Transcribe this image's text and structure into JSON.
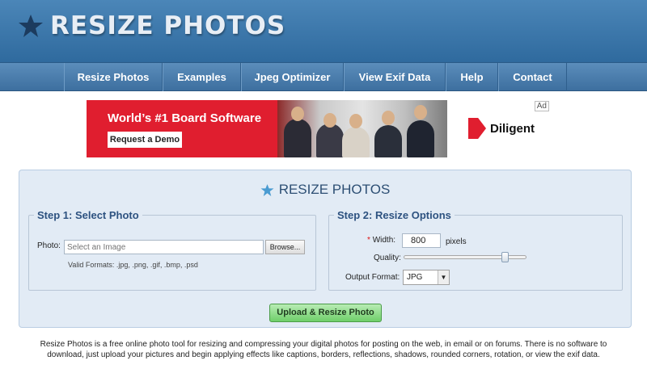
{
  "header": {
    "logo_text": "RESIZE PHOTOS",
    "logo_icon": "star-icon"
  },
  "nav": {
    "items": [
      {
        "label": "Resize Photos"
      },
      {
        "label": "Examples"
      },
      {
        "label": "Jpeg Optimizer"
      },
      {
        "label": "View Exif Data"
      },
      {
        "label": "Help"
      },
      {
        "label": "Contact"
      }
    ]
  },
  "ad": {
    "title": "World’s #1 Board Software",
    "cta": "Request a Demo",
    "brand": "Diligent",
    "badge": "Ad"
  },
  "panel": {
    "title": "RESIZE PHOTOS",
    "step1": {
      "legend": "Step 1: Select Photo",
      "photo_label": "Photo:",
      "photo_placeholder": "Select an Image",
      "browse_label": "Browse...",
      "valid_formats": "Valid Formats: .jpg, .png, .gif, .bmp, .psd"
    },
    "step2": {
      "legend": "Step 2: Resize Options",
      "required_mark": "*",
      "width_label": "Width:",
      "width_value": "800",
      "width_unit": "pixels",
      "quality_label": "Quality:",
      "quality_value": 0.85,
      "format_label": "Output Format:",
      "format_value": "JPG"
    },
    "submit_label": "Upload & Resize Photo"
  },
  "footer": {
    "text": "Resize Photos is a free online photo tool for resizing and compressing your digital photos for posting on the web, in email or on forums. There is no software to download, just upload your pictures and begin applying effects like captions, borders, reflections, shadows, rounded corners, rotation, or view the exif data."
  },
  "colors": {
    "header": "#3a76aa",
    "nav": "#4a7fb0",
    "panel": "#e2ebf5",
    "accent_red": "#e01e2f",
    "button_green": "#8fdc8a"
  }
}
